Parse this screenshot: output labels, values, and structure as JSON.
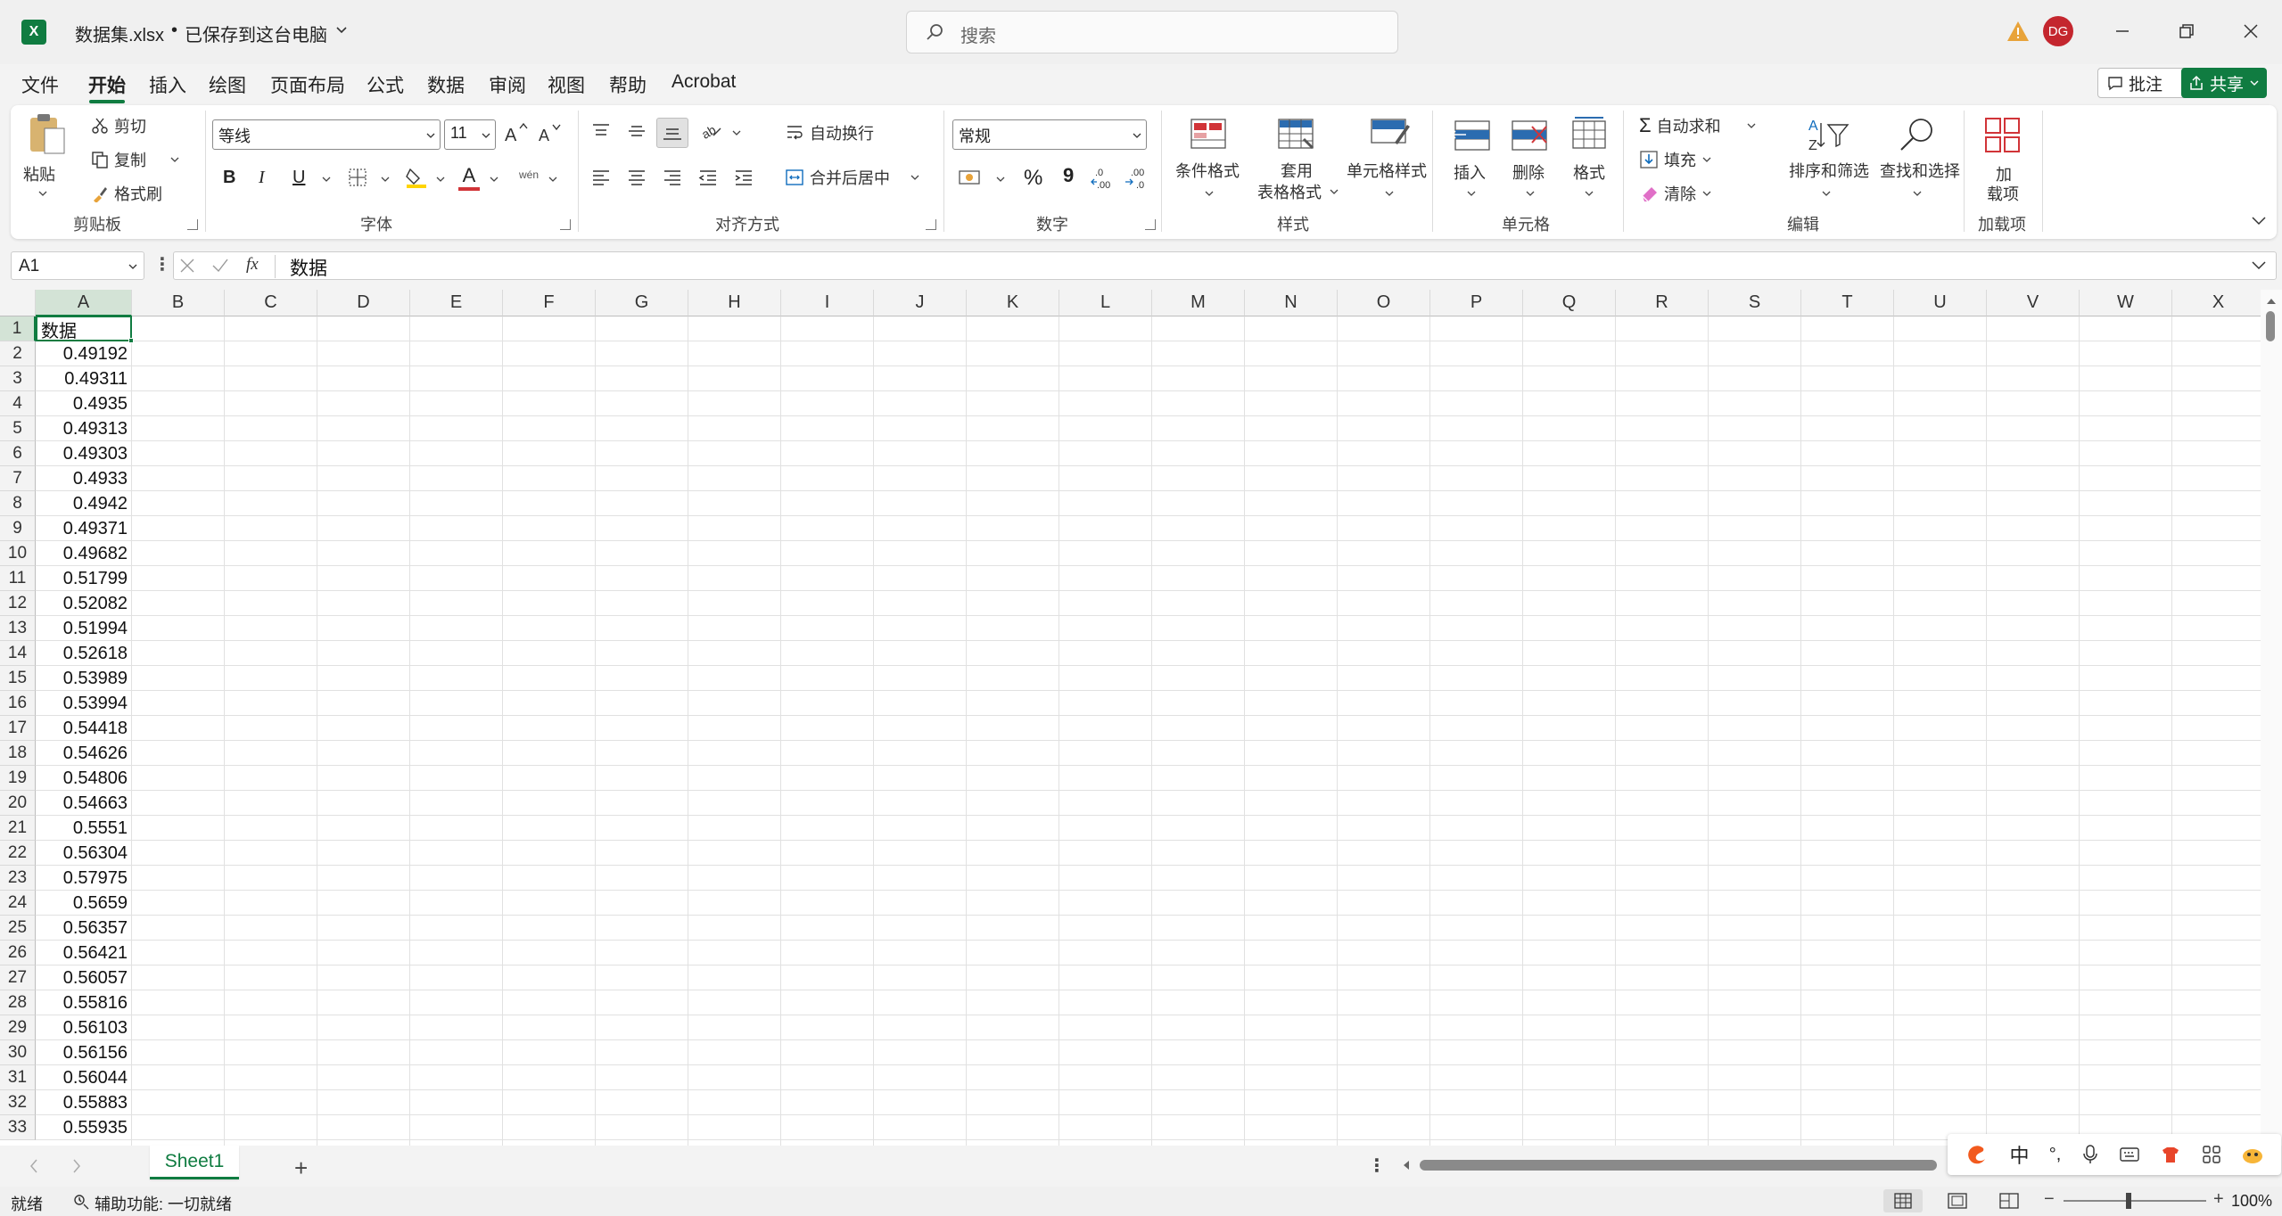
{
  "title": {
    "filename": "数据集.xlsx",
    "bullet": "•",
    "save_status": "已保存到这台电脑",
    "search_placeholder": "搜索",
    "avatar": "DG"
  },
  "menu": [
    "文件",
    "开始",
    "插入",
    "绘图",
    "页面布局",
    "公式",
    "数据",
    "审阅",
    "视图",
    "帮助",
    "Acrobat"
  ],
  "menu_active": "开始",
  "menu_right": {
    "comment": "批注",
    "share": "共享"
  },
  "ribbon": {
    "clipboard": {
      "paste": "粘贴",
      "cut": "剪切",
      "copy": "复制",
      "format_painter": "格式刷",
      "label": "剪贴板"
    },
    "font": {
      "name": "等线",
      "size": "11",
      "label": "字体",
      "bold": "B",
      "italic": "I",
      "underline": "U",
      "font_color_letter": "A",
      "phonetic": "wén"
    },
    "alignment": {
      "wrap": "自动换行",
      "merge": "合并后居中",
      "label": "对齐方式"
    },
    "number": {
      "format": "常规",
      "percent": "%",
      "comma": "9",
      "label": "数字"
    },
    "styles": {
      "conditional": "条件格式",
      "table_line1": "套用",
      "table_line2": "表格格式",
      "cell_styles": "单元格样式",
      "label": "样式"
    },
    "cells": {
      "insert": "插入",
      "delete": "删除",
      "format": "格式",
      "label": "单元格"
    },
    "editing": {
      "autosum": "自动求和",
      "fill": "填充",
      "clear": "清除",
      "sort": "排序和筛选",
      "find": "查找和选择",
      "label": "编辑"
    },
    "addins": {
      "line1": "加",
      "line2": "载项",
      "label": "加载项"
    },
    "accent_color": "#107c41",
    "red_color": "#d13438"
  },
  "formula_bar": {
    "name_box": "A1",
    "fx": "fx",
    "content": "数据"
  },
  "columns": [
    "A",
    "B",
    "C",
    "D",
    "E",
    "F",
    "G",
    "H",
    "I",
    "J",
    "K",
    "L",
    "M",
    "N",
    "O",
    "P",
    "Q",
    "R",
    "S",
    "T",
    "U",
    "V",
    "W",
    "X"
  ],
  "rows": [
    {
      "n": "1",
      "a": "数据"
    },
    {
      "n": "2",
      "a": "0.49192"
    },
    {
      "n": "3",
      "a": "0.49311"
    },
    {
      "n": "4",
      "a": "0.4935"
    },
    {
      "n": "5",
      "a": "0.49313"
    },
    {
      "n": "6",
      "a": "0.49303"
    },
    {
      "n": "7",
      "a": "0.4933"
    },
    {
      "n": "8",
      "a": "0.4942"
    },
    {
      "n": "9",
      "a": "0.49371"
    },
    {
      "n": "10",
      "a": "0.49682"
    },
    {
      "n": "11",
      "a": "0.51799"
    },
    {
      "n": "12",
      "a": "0.52082"
    },
    {
      "n": "13",
      "a": "0.51994"
    },
    {
      "n": "14",
      "a": "0.52618"
    },
    {
      "n": "15",
      "a": "0.53989"
    },
    {
      "n": "16",
      "a": "0.53994"
    },
    {
      "n": "17",
      "a": "0.54418"
    },
    {
      "n": "18",
      "a": "0.54626"
    },
    {
      "n": "19",
      "a": "0.54806"
    },
    {
      "n": "20",
      "a": "0.54663"
    },
    {
      "n": "21",
      "a": "0.5551"
    },
    {
      "n": "22",
      "a": "0.56304"
    },
    {
      "n": "23",
      "a": "0.57975"
    },
    {
      "n": "24",
      "a": "0.5659"
    },
    {
      "n": "25",
      "a": "0.56357"
    },
    {
      "n": "26",
      "a": "0.56421"
    },
    {
      "n": "27",
      "a": "0.56057"
    },
    {
      "n": "28",
      "a": "0.55816"
    },
    {
      "n": "29",
      "a": "0.56103"
    },
    {
      "n": "30",
      "a": "0.56156"
    },
    {
      "n": "31",
      "a": "0.56044"
    },
    {
      "n": "32",
      "a": "0.55883"
    },
    {
      "n": "33",
      "a": "0.55935"
    }
  ],
  "sheet_tab": "Sheet1",
  "status": {
    "ready": "就绪",
    "accessibility": "辅助功能: 一切就绪",
    "zoom": "100%"
  },
  "ime": {
    "mode": "中"
  }
}
